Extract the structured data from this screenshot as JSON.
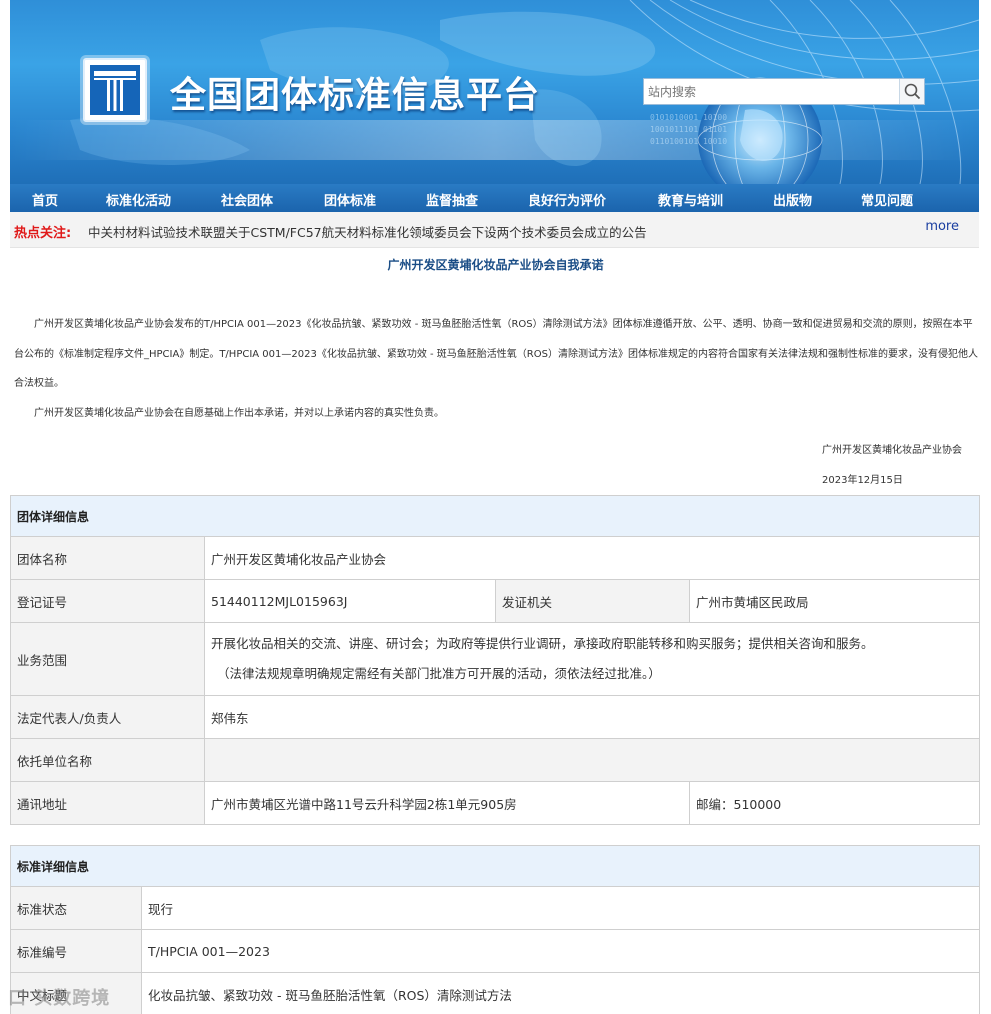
{
  "header": {
    "site_title": "全国团体标准信息平台",
    "search_placeholder": "站内搜索"
  },
  "nav": {
    "items": [
      "首页",
      "标准化活动",
      "社会团体",
      "团体标准",
      "监督抽查",
      "良好行为评价",
      "教育与培训",
      "出版物",
      "常见问题"
    ]
  },
  "hot": {
    "label": "热点关注:",
    "text": "中关村材料试验技术联盟关于CSTM/FC57航天材料标准化领域委员会下设两个技术委员会成立的公告",
    "more": "more"
  },
  "commitment": {
    "title": "广州开发区黄埔化妆品产业协会自我承诺",
    "para1": "广州开发区黄埔化妆品产业协会发布的T/HPCIA 001—2023《化妆品抗皱、紧致功效 - 斑马鱼胚胎活性氧（ROS）清除测试方法》团体标准遵循开放、公平、透明、协商一致和促进贸易和交流的原则，按照在本平台公布的《标准制定程序文件_HPCIA》制定。T/HPCIA 001—2023《化妆品抗皱、紧致功效 - 斑马鱼胚胎活性氧（ROS）清除测试方法》团体标准规定的内容符合国家有关法律法规和强制性标准的要求，没有侵犯他人合法权益。",
    "para2": "广州开发区黄埔化妆品产业协会在自愿基础上作出本承诺，并对以上承诺内容的真实性负责。",
    "signer": "广州开发区黄埔化妆品产业协会",
    "date": "2023年12月15日"
  },
  "org": {
    "header": "团体详细信息",
    "name_label": "团体名称",
    "name_value": "广州开发区黄埔化妆品产业协会",
    "reg_label": "登记证号",
    "reg_value": "51440112MJL015963J",
    "issuer_label": "发证机关",
    "issuer_value": "广州市黄埔区民政局",
    "scope_label": "业务范围",
    "scope_line1": "开展化妆品相关的交流、讲座、研讨会；为政府等提供行业调研，承接政府职能转移和购买服务；提供相关咨询和服务。",
    "scope_line2": "（法律法规规章明确规定需经有关部门批准方可开展的活动，须依法经过批准。）",
    "rep_label": "法定代表人/负责人",
    "rep_value": "郑伟东",
    "entrust_label": "依托单位名称",
    "entrust_value": "",
    "addr_label": "通讯地址",
    "addr_value": "广州市黄埔区光谱中路11号云升科学园2栋1单元905房",
    "zip_value": "邮编：510000"
  },
  "standard": {
    "header": "标准详细信息",
    "status_label": "标准状态",
    "status_value": "现行",
    "code_label": "标准编号",
    "code_value": "T/HPCIA 001—2023",
    "cn_title_label": "中文标题",
    "cn_title_value": "化妆品抗皱、紧致功效 - 斑马鱼胚胎活性氧（ROS）清除测试方法"
  },
  "watermark": "口 头数跨境"
}
